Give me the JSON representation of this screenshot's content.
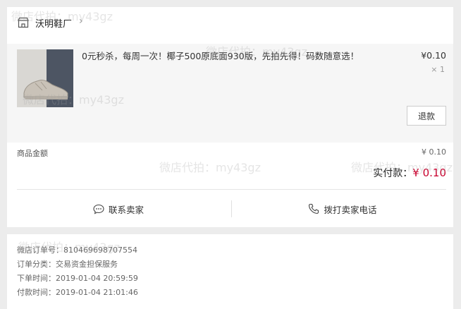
{
  "shop": {
    "name": "沃明鞋厂",
    "icon": "store-icon",
    "chevron": "›"
  },
  "product": {
    "title": "0元秒杀，每周一次！椰子500原底面930版，先拍先得！码数随意选！",
    "price": "¥0.10",
    "quantity": "× 1",
    "refund_label": "退款"
  },
  "summary": {
    "goods_amount_label": "商品金额",
    "goods_amount_value": "¥ 0.10",
    "paid_label": "实付款：",
    "paid_value": "¥ 0.10"
  },
  "actions": {
    "contact_seller": "联系卖家",
    "call_seller": "拨打卖家电话"
  },
  "order_info": {
    "order_no": "微店订单号：810469698707554",
    "order_type": "订单分类：交易资金担保服务",
    "order_time": "下单时间：2019-01-04 20:59:59",
    "pay_time": "付款时间：2019-01-04 21:01:46"
  },
  "watermark": "微店代拍：my43gz",
  "colors": {
    "accent": "#c8002d",
    "page_bg": "#ececec",
    "panel_bg": "#f6f6f6"
  }
}
